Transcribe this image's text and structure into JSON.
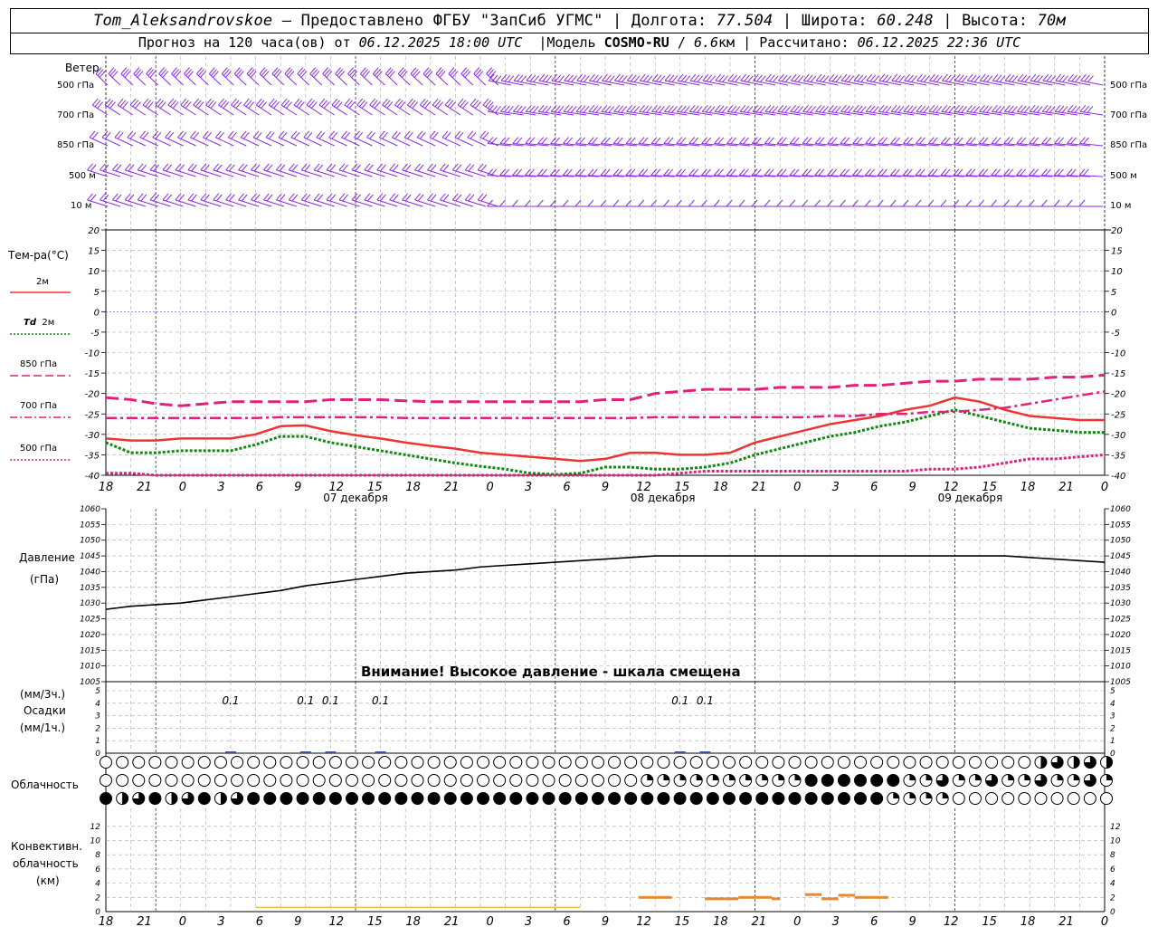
{
  "header": {
    "station": "Tom_Aleksandrovskoe",
    "provided": "Предоставлено ФГБУ \"ЗапСиб УГМС\"",
    "lon_label": "Долгота:",
    "lon": "77.504",
    "lat_label": "Широта:",
    "lat": "60.248",
    "alt_label": "Высота:",
    "alt": "70м",
    "forecast_prefix": "Прогноз на 120 часа(ов) от",
    "forecast_start": "06.12.2025 18:00 UTC",
    "model_label": "Модель",
    "model": "COSMO-RU",
    "model_res": "6.6",
    "model_res_unit": "км",
    "calc_label": "Рассчитано:",
    "calc_time": "06.12.2025 22:36 UTC"
  },
  "wind_panel": {
    "title": "Ветер",
    "levels": [
      "500 гПа",
      "700 гПа",
      "850 гПа",
      "500 м",
      "10 м"
    ],
    "color": "#8a2be2"
  },
  "temp_panel": {
    "title": "Тем-ра(°С)",
    "legend": [
      {
        "label": "2м",
        "color": "#ee3333",
        "style": "solid"
      },
      {
        "label_it": "Td",
        "label": "2м",
        "color": "#118811",
        "style": "dotted"
      },
      {
        "label": "850 гПа",
        "color": "#e0207a",
        "style": "long-dash"
      },
      {
        "label": "700 гПа",
        "color": "#e0207a",
        "style": "dash-dot"
      },
      {
        "label": "500 гПа",
        "color": "#e0207a",
        "style": "dotted"
      }
    ],
    "yticks": [
      20,
      15,
      10,
      5,
      0,
      -5,
      -10,
      -15,
      -20,
      -25,
      -30,
      -35,
      -40
    ]
  },
  "time_axis": {
    "hour_labels": [
      "18",
      "21",
      "0",
      "3",
      "6",
      "9",
      "12",
      "15",
      "18",
      "21",
      "0",
      "3",
      "6",
      "9",
      "12",
      "15",
      "18",
      "21",
      "0",
      "3",
      "6",
      "9",
      "12",
      "15",
      "18",
      "21",
      "0"
    ],
    "days": [
      "07 декабря",
      "08 декабря",
      "09 декабря"
    ]
  },
  "pressure_panel": {
    "title1": "Давление",
    "title2": "(гПа)",
    "yticks": [
      1060,
      1055,
      1050,
      1045,
      1040,
      1035,
      1030,
      1025,
      1020,
      1015,
      1010,
      1005
    ],
    "warning": "Внимание! Высокое давление - шкала смещена"
  },
  "precip_panel": {
    "title1": "(мм/3ч.)",
    "title2": "Осадки",
    "title3": "(мм/1ч.)",
    "yticks": [
      5,
      4,
      3,
      2,
      1,
      0
    ],
    "labels": [
      {
        "t": 15,
        "text": "0.1"
      },
      {
        "t": 24,
        "text": "0.1"
      },
      {
        "t": 27,
        "text": "0.1"
      },
      {
        "t": 33,
        "text": "0.1"
      },
      {
        "t": 69,
        "text": "0.1"
      },
      {
        "t": 72,
        "text": "0.1"
      }
    ]
  },
  "cloud_panel": {
    "title": "Облачность"
  },
  "conv_panel": {
    "title1": "Конвективн.",
    "title2": "облачность",
    "title3": "(км)",
    "yticks": [
      12,
      10,
      8,
      6,
      4,
      2,
      0
    ]
  },
  "chart_data": [
    {
      "type": "line",
      "title": "Тем-ра(°С)",
      "x_hours": [
        0,
        3,
        6,
        9,
        12,
        15,
        18,
        21,
        24,
        27,
        30,
        33,
        36,
        39,
        42,
        45,
        48,
        51,
        54,
        57,
        60,
        63,
        66,
        69,
        72,
        75,
        78,
        81,
        84,
        87,
        90,
        93,
        96,
        99,
        102,
        105,
        108,
        111,
        114,
        117,
        120
      ],
      "ylim": [
        -40,
        20
      ],
      "series": [
        {
          "name": "2м",
          "values": [
            -31.0,
            -31.5,
            -31.5,
            -31.0,
            -31.0,
            -31.0,
            -30.0,
            -28.0,
            -27.8,
            -29.2,
            -30.2,
            -31.0,
            -32.0,
            -32.8,
            -33.5,
            -34.5,
            -35.0,
            -35.5,
            -36.0,
            -36.5,
            -36.0,
            -34.5,
            -34.5,
            -35.0,
            -35.0,
            -34.5,
            -32.0,
            -30.5,
            -29.0,
            -27.5,
            -26.5,
            -25.5,
            -24.0,
            -23.0,
            -21.0,
            -22.0,
            -24.0,
            -25.5,
            -26.0,
            -26.5,
            -26.5
          ]
        },
        {
          "name": "Td 2м",
          "values": [
            -32.0,
            -34.5,
            -34.5,
            -34.0,
            -34.0,
            -34.0,
            -32.5,
            -30.5,
            -30.5,
            -32.0,
            -33.0,
            -34.0,
            -35.0,
            -36.0,
            -37.0,
            -37.8,
            -38.5,
            -39.5,
            -39.8,
            -39.5,
            -38.0,
            -38.0,
            -38.5,
            -38.5,
            -38.0,
            -37.0,
            -35.0,
            -33.5,
            -32.0,
            -30.5,
            -29.5,
            -28.0,
            -27.0,
            -25.5,
            -24.0,
            -25.5,
            -27.0,
            -28.5,
            -29.0,
            -29.5,
            -29.5
          ]
        },
        {
          "name": "850 гПа",
          "values": [
            -21.0,
            -21.5,
            -22.5,
            -23.0,
            -22.5,
            -22.0,
            -22.0,
            -22.0,
            -22.0,
            -21.5,
            -21.5,
            -21.5,
            -21.8,
            -22.0,
            -22.0,
            -22.0,
            -22.0,
            -22.0,
            -22.0,
            -22.0,
            -21.5,
            -21.5,
            -20.0,
            -19.5,
            -19.0,
            -19.0,
            -19.0,
            -18.5,
            -18.5,
            -18.5,
            -18.0,
            -18.0,
            -17.5,
            -17.0,
            -17.0,
            -16.5,
            -16.5,
            -16.5,
            -16.0,
            -16.0,
            -15.5
          ]
        },
        {
          "name": "700 гПа",
          "values": [
            -26.0,
            -26.0,
            -26.0,
            -26.0,
            -26.0,
            -26.0,
            -26.0,
            -25.8,
            -25.8,
            -25.8,
            -25.8,
            -25.8,
            -26.0,
            -26.0,
            -26.0,
            -26.0,
            -26.0,
            -26.0,
            -26.0,
            -26.0,
            -26.0,
            -26.0,
            -25.8,
            -25.8,
            -25.8,
            -25.8,
            -25.8,
            -25.8,
            -25.8,
            -25.5,
            -25.5,
            -25.0,
            -25.0,
            -24.5,
            -24.5,
            -24.0,
            -23.5,
            -22.5,
            -21.5,
            -20.5,
            -19.5
          ]
        },
        {
          "name": "500 гПа",
          "values": [
            -39.5,
            -39.5,
            -40.0,
            -40.0,
            -40.0,
            -40.0,
            -40.0,
            -40.0,
            -40.0,
            -40.0,
            -40.0,
            -40.0,
            -40.0,
            -40.0,
            -40.0,
            -40.0,
            -40.0,
            -40.0,
            -40.0,
            -40.0,
            -40.0,
            -40.0,
            -40.0,
            -39.5,
            -39.0,
            -39.0,
            -39.0,
            -39.0,
            -39.0,
            -39.0,
            -39.0,
            -39.0,
            -39.0,
            -38.5,
            -38.5,
            -38.0,
            -37.0,
            -36.0,
            -36.0,
            -35.5,
            -35.0
          ]
        }
      ]
    },
    {
      "type": "line",
      "title": "Давление (гПа)",
      "x_hours": [
        0,
        3,
        6,
        9,
        12,
        15,
        18,
        21,
        24,
        27,
        30,
        33,
        36,
        39,
        42,
        45,
        48,
        51,
        54,
        57,
        60,
        63,
        66,
        69,
        72,
        75,
        78,
        81,
        84,
        87,
        90,
        93,
        96,
        99,
        102,
        105,
        108,
        111,
        114,
        117,
        120
      ],
      "ylim": [
        1005,
        1060
      ],
      "series": [
        {
          "name": "Давление",
          "values": [
            1028,
            1029,
            1029.5,
            1030,
            1031,
            1032,
            1033,
            1034,
            1035.5,
            1036.5,
            1037.5,
            1038.5,
            1039.5,
            1040,
            1040.5,
            1041.5,
            1042,
            1042.5,
            1043,
            1043.5,
            1044,
            1044.5,
            1045,
            1045,
            1045,
            1045,
            1045,
            1045,
            1045,
            1045,
            1045,
            1045,
            1045,
            1045,
            1045,
            1045,
            1045,
            1044.5,
            1044,
            1043.5,
            1043
          ]
        }
      ]
    },
    {
      "type": "bar",
      "title": "Осадки",
      "x_hours": [
        15,
        24,
        27,
        33,
        69,
        72
      ],
      "ylim": [
        0,
        5
      ],
      "values": [
        0.1,
        0.1,
        0.1,
        0.1,
        0.1,
        0.1
      ]
    },
    {
      "type": "bar",
      "title": "Конвективн. облачность (км)",
      "ylim": [
        0,
        12
      ],
      "series": [
        {
          "name": "orange",
          "segments": [
            [
              64,
              68,
              2
            ],
            [
              72,
              76,
              1.8
            ],
            [
              76,
              78,
              2
            ],
            [
              78,
              80,
              2
            ],
            [
              80,
              81,
              1.8
            ],
            [
              84,
              86,
              2.4
            ],
            [
              86,
              88,
              1.8
            ],
            [
              88,
              90,
              2.3
            ],
            [
              90,
              92,
              2
            ],
            [
              92,
              94,
              2
            ]
          ]
        },
        {
          "name": "yellow",
          "segments": [
            [
              18,
              57,
              0.5
            ]
          ]
        }
      ]
    }
  ]
}
